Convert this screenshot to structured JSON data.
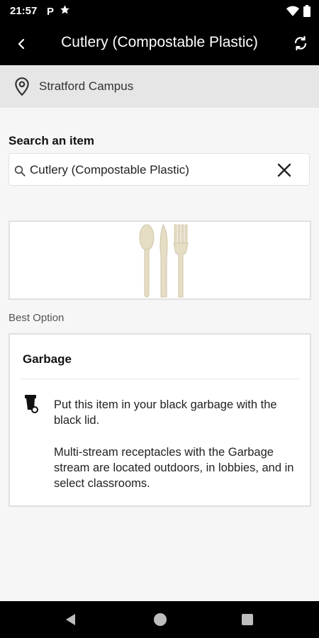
{
  "status_bar": {
    "time": "21:57",
    "p_icon": "P",
    "icons": [
      "parking-p-icon",
      "star-icon",
      "wifi-icon",
      "battery-icon"
    ]
  },
  "app_bar": {
    "title": "Cutlery (Compostable Plastic)",
    "back_icon": "chevron-left-icon",
    "refresh_icon": "refresh-icon"
  },
  "location": {
    "icon": "location-pin-icon",
    "label": "Stratford Campus"
  },
  "search": {
    "heading": "Search an item",
    "value": "Cutlery (Compostable Plastic)",
    "icon": "search-icon",
    "clear_icon": "close-icon"
  },
  "item_image": {
    "icon": "cutlery-image"
  },
  "best_option": {
    "label": "Best Option",
    "title": "Garbage",
    "icon": "garbage-bin-icon",
    "instruction": "Put this item in your black garbage with the black lid.",
    "details": "Multi-stream receptacles with the Garbage stream are located outdoors, in lobbies, and in select classrooms."
  },
  "nav_bar": {
    "icons": [
      "nav-back-icon",
      "nav-home-icon",
      "nav-recent-icon"
    ]
  },
  "colors": {
    "app_bar_bg": "#000000",
    "location_bg": "#e6e6e6",
    "page_bg": "#f6f6f6",
    "cutlery": "#e5ddc4"
  }
}
